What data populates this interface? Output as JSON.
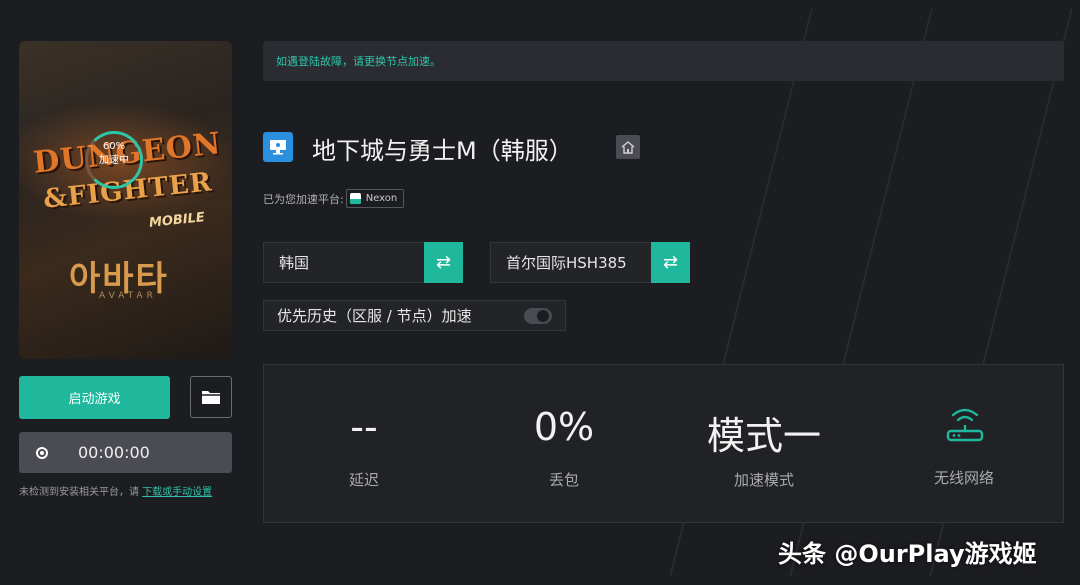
{
  "notice": "如遇登陆故障，请更换节点加速。",
  "game": {
    "title": "地下城与勇士M（韩服）",
    "cover_logo_line1": "DUNGEON",
    "cover_logo_line2": "&FIGHTER",
    "cover_logo_line3": "MOBILE",
    "cover_korean": "아바타",
    "cover_sub": "AVATAR",
    "progress_percent": "60%",
    "progress_status": "加速中"
  },
  "platform": {
    "label": "已为您加速平台:",
    "name": "Nexon"
  },
  "region": {
    "value": "韩国",
    "swap_icon": "swap-icon"
  },
  "node": {
    "value": "首尔国际HSH385",
    "swap_icon": "swap-icon"
  },
  "history_toggle": {
    "label": "优先历史（区服 / 节点）加速",
    "enabled": false
  },
  "actions": {
    "start_label": "启动游戏",
    "folder_icon": "folder-icon",
    "timer": "00:00:00"
  },
  "footer_note": {
    "text": "未检测到安装相关平台，请 ",
    "link": "下载或手动设置"
  },
  "stats": [
    {
      "value": "--",
      "label": "延迟"
    },
    {
      "value": "0%",
      "label": "丢包"
    },
    {
      "value": "模式一",
      "label": "加速模式"
    },
    {
      "value": "",
      "label": "无线网络"
    }
  ],
  "colors": {
    "accent": "#1fb89c",
    "background": "#1c1d21",
    "panel": "#212226"
  },
  "watermark": "头条 @OurPlay游戏姬"
}
